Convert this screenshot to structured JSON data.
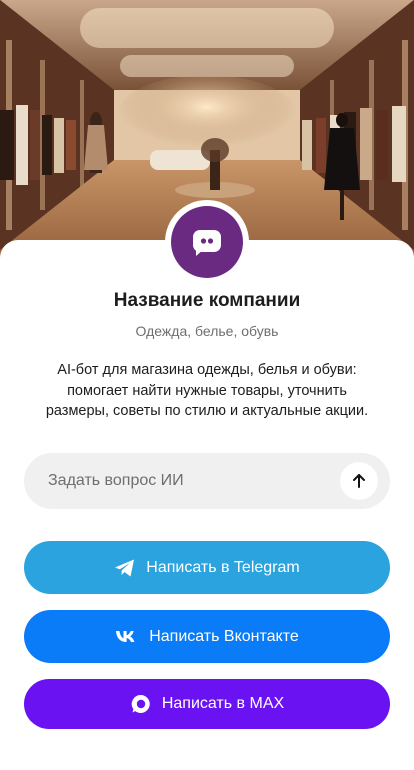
{
  "company": {
    "name": "Название компании",
    "category": "Одежда, белье, обувь",
    "description": "AI-бот для магазина одежды, белья и обуви: помогает найти нужные товары, уточнить размеры, советы по стилю и актуальные акции."
  },
  "hero": {
    "icon": "store-interior-photo"
  },
  "avatar": {
    "icon": "chat-bot-icon",
    "color": "#6b2a82"
  },
  "ask": {
    "placeholder": "Задать вопрос ИИ",
    "value": "",
    "send_icon": "arrow-up-icon"
  },
  "buttons": {
    "telegram": {
      "label": "Написать в Telegram",
      "icon": "telegram-icon",
      "color": "#2aa3df"
    },
    "vk": {
      "label": "Написать Вконтакте",
      "icon": "vk-icon",
      "color": "#0a7cf8"
    },
    "max": {
      "label": "Написать в MAX",
      "icon": "max-icon",
      "color": "#6a12f2"
    }
  }
}
